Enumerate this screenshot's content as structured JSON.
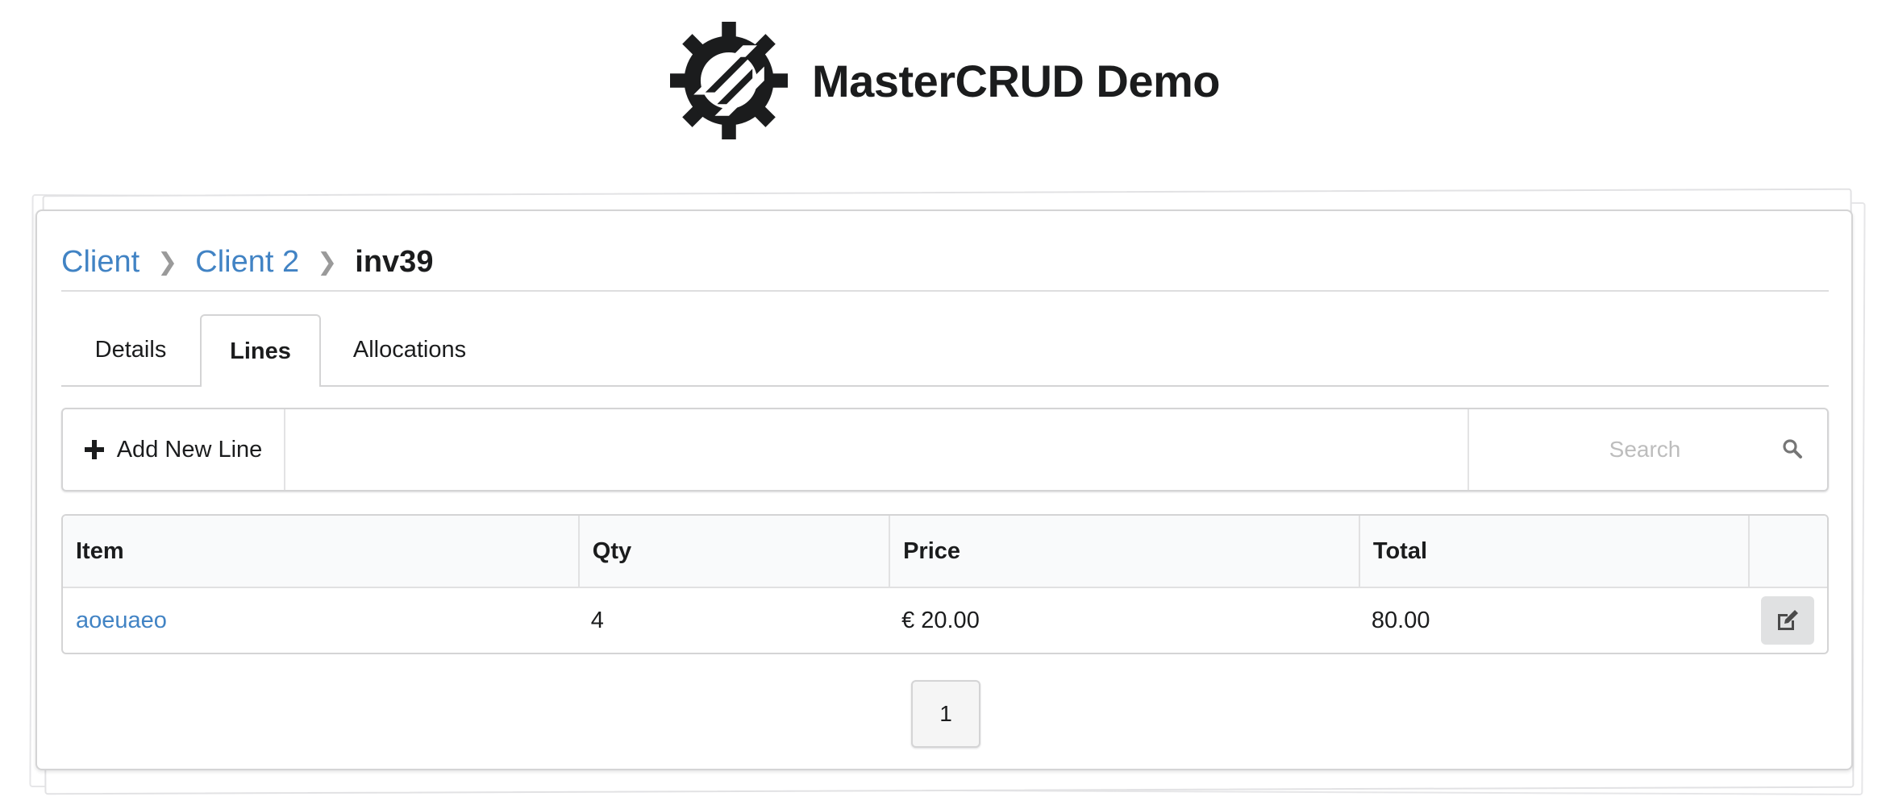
{
  "header": {
    "logo_icon": "gear-slash-logo",
    "title": "MasterCRUD Demo"
  },
  "breadcrumb": {
    "items": [
      {
        "label": "Client",
        "link": true
      },
      {
        "label": "Client 2",
        "link": true
      },
      {
        "label": "inv39",
        "link": false
      }
    ],
    "separator_icon": "chevron-right-icon"
  },
  "tabs": [
    {
      "label": "Details",
      "active": false
    },
    {
      "label": "Lines",
      "active": true
    },
    {
      "label": "Allocations",
      "active": false
    }
  ],
  "toolbar": {
    "add_label": "Add New Line",
    "add_icon": "plus-icon",
    "search_placeholder": "Search",
    "search_value": "",
    "search_icon": "search-icon"
  },
  "table": {
    "columns": [
      "Item",
      "Qty",
      "Price",
      "Total",
      ""
    ],
    "rows": [
      {
        "item": "aoeuaeo",
        "qty": "4",
        "price": "€ 20.00",
        "total": "80.00",
        "action_icon": "edit-icon"
      }
    ]
  },
  "pagination": {
    "pages": [
      "1"
    ],
    "current": "1"
  },
  "colors": {
    "link": "#4183c4",
    "border": "#d4d4d5",
    "header_bg": "#f9fafb",
    "button_bg": "#e0e1e2"
  }
}
